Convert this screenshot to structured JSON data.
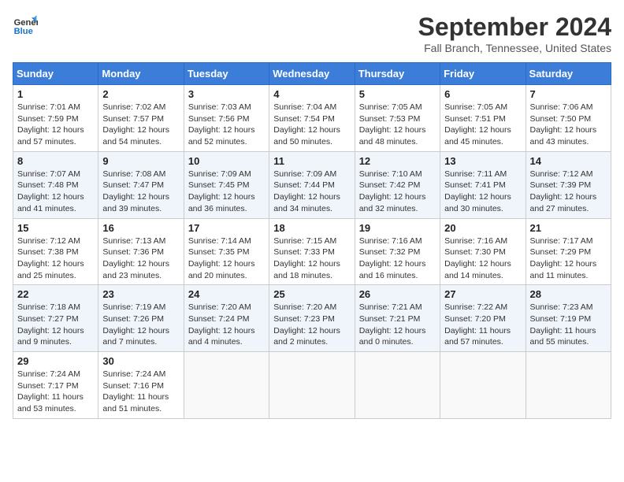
{
  "header": {
    "logo_line1": "General",
    "logo_line2": "Blue",
    "month_title": "September 2024",
    "location": "Fall Branch, Tennessee, United States"
  },
  "weekdays": [
    "Sunday",
    "Monday",
    "Tuesday",
    "Wednesday",
    "Thursday",
    "Friday",
    "Saturday"
  ],
  "weeks": [
    [
      {
        "day": "1",
        "sunrise": "7:01 AM",
        "sunset": "7:59 PM",
        "daylight": "12 hours and 57 minutes."
      },
      {
        "day": "2",
        "sunrise": "7:02 AM",
        "sunset": "7:57 PM",
        "daylight": "12 hours and 54 minutes."
      },
      {
        "day": "3",
        "sunrise": "7:03 AM",
        "sunset": "7:56 PM",
        "daylight": "12 hours and 52 minutes."
      },
      {
        "day": "4",
        "sunrise": "7:04 AM",
        "sunset": "7:54 PM",
        "daylight": "12 hours and 50 minutes."
      },
      {
        "day": "5",
        "sunrise": "7:05 AM",
        "sunset": "7:53 PM",
        "daylight": "12 hours and 48 minutes."
      },
      {
        "day": "6",
        "sunrise": "7:05 AM",
        "sunset": "7:51 PM",
        "daylight": "12 hours and 45 minutes."
      },
      {
        "day": "7",
        "sunrise": "7:06 AM",
        "sunset": "7:50 PM",
        "daylight": "12 hours and 43 minutes."
      }
    ],
    [
      {
        "day": "8",
        "sunrise": "7:07 AM",
        "sunset": "7:48 PM",
        "daylight": "12 hours and 41 minutes."
      },
      {
        "day": "9",
        "sunrise": "7:08 AM",
        "sunset": "7:47 PM",
        "daylight": "12 hours and 39 minutes."
      },
      {
        "day": "10",
        "sunrise": "7:09 AM",
        "sunset": "7:45 PM",
        "daylight": "12 hours and 36 minutes."
      },
      {
        "day": "11",
        "sunrise": "7:09 AM",
        "sunset": "7:44 PM",
        "daylight": "12 hours and 34 minutes."
      },
      {
        "day": "12",
        "sunrise": "7:10 AM",
        "sunset": "7:42 PM",
        "daylight": "12 hours and 32 minutes."
      },
      {
        "day": "13",
        "sunrise": "7:11 AM",
        "sunset": "7:41 PM",
        "daylight": "12 hours and 30 minutes."
      },
      {
        "day": "14",
        "sunrise": "7:12 AM",
        "sunset": "7:39 PM",
        "daylight": "12 hours and 27 minutes."
      }
    ],
    [
      {
        "day": "15",
        "sunrise": "7:12 AM",
        "sunset": "7:38 PM",
        "daylight": "12 hours and 25 minutes."
      },
      {
        "day": "16",
        "sunrise": "7:13 AM",
        "sunset": "7:36 PM",
        "daylight": "12 hours and 23 minutes."
      },
      {
        "day": "17",
        "sunrise": "7:14 AM",
        "sunset": "7:35 PM",
        "daylight": "12 hours and 20 minutes."
      },
      {
        "day": "18",
        "sunrise": "7:15 AM",
        "sunset": "7:33 PM",
        "daylight": "12 hours and 18 minutes."
      },
      {
        "day": "19",
        "sunrise": "7:16 AM",
        "sunset": "7:32 PM",
        "daylight": "12 hours and 16 minutes."
      },
      {
        "day": "20",
        "sunrise": "7:16 AM",
        "sunset": "7:30 PM",
        "daylight": "12 hours and 14 minutes."
      },
      {
        "day": "21",
        "sunrise": "7:17 AM",
        "sunset": "7:29 PM",
        "daylight": "12 hours and 11 minutes."
      }
    ],
    [
      {
        "day": "22",
        "sunrise": "7:18 AM",
        "sunset": "7:27 PM",
        "daylight": "12 hours and 9 minutes."
      },
      {
        "day": "23",
        "sunrise": "7:19 AM",
        "sunset": "7:26 PM",
        "daylight": "12 hours and 7 minutes."
      },
      {
        "day": "24",
        "sunrise": "7:20 AM",
        "sunset": "7:24 PM",
        "daylight": "12 hours and 4 minutes."
      },
      {
        "day": "25",
        "sunrise": "7:20 AM",
        "sunset": "7:23 PM",
        "daylight": "12 hours and 2 minutes."
      },
      {
        "day": "26",
        "sunrise": "7:21 AM",
        "sunset": "7:21 PM",
        "daylight": "12 hours and 0 minutes."
      },
      {
        "day": "27",
        "sunrise": "7:22 AM",
        "sunset": "7:20 PM",
        "daylight": "11 hours and 57 minutes."
      },
      {
        "day": "28",
        "sunrise": "7:23 AM",
        "sunset": "7:19 PM",
        "daylight": "11 hours and 55 minutes."
      }
    ],
    [
      {
        "day": "29",
        "sunrise": "7:24 AM",
        "sunset": "7:17 PM",
        "daylight": "11 hours and 53 minutes."
      },
      {
        "day": "30",
        "sunrise": "7:24 AM",
        "sunset": "7:16 PM",
        "daylight": "11 hours and 51 minutes."
      },
      null,
      null,
      null,
      null,
      null
    ]
  ]
}
